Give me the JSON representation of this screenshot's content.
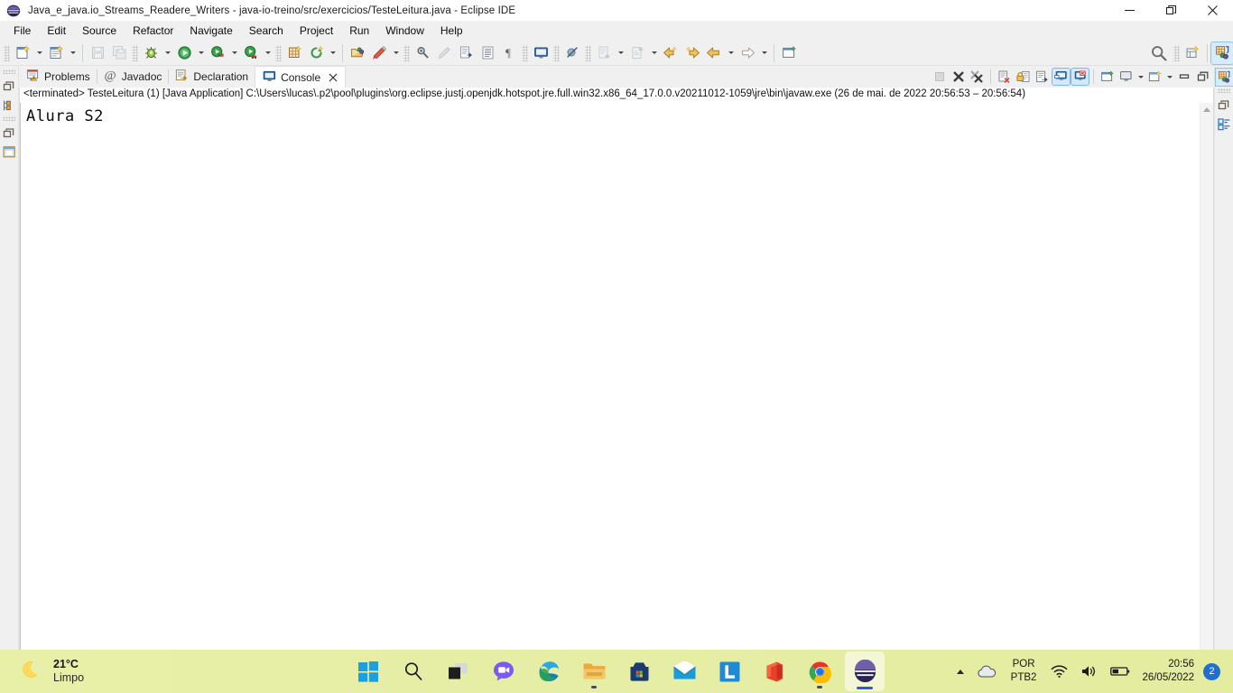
{
  "window": {
    "title": "Java_e_java.io_Streams_Readere_Writers - java-io-treino/src/exercicios/TesteLeitura.java - Eclipse IDE",
    "app_icon": "eclipse-icon",
    "minimize_label": "Minimize",
    "restore_label": "Restore",
    "close_label": "Close"
  },
  "menubar": {
    "items": [
      {
        "label": "File"
      },
      {
        "label": "Edit"
      },
      {
        "label": "Source"
      },
      {
        "label": "Refactor"
      },
      {
        "label": "Navigate"
      },
      {
        "label": "Search"
      },
      {
        "label": "Project"
      },
      {
        "label": "Run"
      },
      {
        "label": "Window"
      },
      {
        "label": "Help"
      }
    ]
  },
  "toolbar": {
    "buttons": [
      {
        "name": "new-wizard-icon",
        "tooltip": "New"
      },
      {
        "name": "new-java-class-icon",
        "tooltip": "New Java Class"
      },
      {
        "name": "save-icon",
        "tooltip": "Save"
      },
      {
        "name": "save-all-icon",
        "tooltip": "Save All"
      },
      {
        "name": "debug-icon",
        "tooltip": "Debug"
      },
      {
        "name": "run-icon",
        "tooltip": "Run"
      },
      {
        "name": "run-coverage-icon",
        "tooltip": "Coverage"
      },
      {
        "name": "run-external-tools-icon",
        "tooltip": "External Tools"
      },
      {
        "name": "new-java-project-icon",
        "tooltip": "New Java Project"
      },
      {
        "name": "refresh-icon",
        "tooltip": "Refresh"
      },
      {
        "name": "open-type-icon",
        "tooltip": "Open Type"
      },
      {
        "name": "open-task-icon",
        "tooltip": "Open Task"
      },
      {
        "name": "search-marker-icon",
        "tooltip": "Search"
      },
      {
        "name": "pencil-icon",
        "tooltip": "Edit"
      },
      {
        "name": "next-annotation-icon",
        "tooltip": "Next Annotation"
      },
      {
        "name": "toggle-block-selection-icon",
        "tooltip": "Toggle Block Selection"
      },
      {
        "name": "show-whitespace-icon",
        "tooltip": "Show Whitespace Characters"
      },
      {
        "name": "terminal-icon",
        "tooltip": "Terminal"
      },
      {
        "name": "skip-breakpoints-icon",
        "tooltip": "Skip All Breakpoints"
      },
      {
        "name": "previous-edit-icon",
        "tooltip": "Previous Edit Location"
      },
      {
        "name": "next-edit-icon",
        "tooltip": "Next Edit Location"
      },
      {
        "name": "back-icon",
        "tooltip": "Back"
      },
      {
        "name": "forward-icon",
        "tooltip": "Forward"
      },
      {
        "name": "new-window-icon",
        "tooltip": "New Window"
      },
      {
        "name": "search-icon",
        "tooltip": "Search"
      },
      {
        "name": "open-perspective-icon",
        "tooltip": "Open Perspective"
      },
      {
        "name": "java-perspective-icon",
        "tooltip": "Java Perspective"
      }
    ]
  },
  "left_rail": {
    "buttons": [
      {
        "name": "restore-view-icon"
      },
      {
        "name": "package-explorer-icon"
      },
      {
        "name": "restore-view-2-icon"
      },
      {
        "name": "outline-view-icon"
      }
    ]
  },
  "right_rail": {
    "buttons": [
      {
        "name": "java-perspective-icon",
        "active": true
      },
      {
        "name": "restore-view-icon",
        "active": false
      },
      {
        "name": "outline-view-icon",
        "active": false
      }
    ]
  },
  "view_tabs": {
    "tabs": [
      {
        "label": "Problems",
        "icon": "problems-icon",
        "selected": false,
        "closable": false
      },
      {
        "label": "Javadoc",
        "icon": "javadoc-icon",
        "selected": false,
        "closable": false
      },
      {
        "label": "Declaration",
        "icon": "declaration-icon",
        "selected": false,
        "closable": false
      },
      {
        "label": "Console",
        "icon": "console-icon",
        "selected": true,
        "closable": true
      }
    ],
    "tools": [
      {
        "name": "terminate-icon",
        "enabled": false
      },
      {
        "name": "remove-launch-icon",
        "enabled": true
      },
      {
        "name": "remove-all-launches-icon",
        "enabled": true
      },
      {
        "name": "clear-console-icon",
        "enabled": true
      },
      {
        "name": "scroll-lock-icon",
        "enabled": true
      },
      {
        "name": "word-wrap-icon",
        "enabled": true
      },
      {
        "name": "show-console-on-output-icon",
        "enabled": true,
        "toggled": true
      },
      {
        "name": "show-console-on-error-icon",
        "enabled": true,
        "toggled": true
      },
      {
        "name": "pin-console-icon",
        "enabled": true
      },
      {
        "name": "display-selected-console-icon",
        "enabled": true
      },
      {
        "name": "open-console-icon",
        "enabled": true
      },
      {
        "name": "minimize-view-icon",
        "enabled": true
      },
      {
        "name": "maximize-view-icon",
        "enabled": true
      }
    ]
  },
  "console": {
    "status_line": "<terminated> TesteLeitura (1) [Java Application] C:\\Users\\lucas\\.p2\\pool\\plugins\\org.eclipse.justj.openjdk.hotspot.jre.full.win32.x86_64_17.0.0.v20211012-1059\\jre\\bin\\javaw.exe  (26 de mai. de 2022 20:56:53 – 20:56:54)",
    "output_lines": [
      "Alura S2"
    ],
    "scroll": {
      "vertical_up": "scroll-up-arrow",
      "vertical_down": "scroll-down-arrow",
      "horizontal_left": "scroll-left-arrow",
      "horizontal_right": "scroll-right-arrow"
    }
  },
  "status_bar": {
    "tip_icon": "light-bulb-icon"
  },
  "taskbar": {
    "weather": {
      "temperature": "21°C",
      "condition": "Limpo",
      "icon": "moon-icon"
    },
    "apps": [
      {
        "name": "start-button",
        "label": "Start",
        "active": false,
        "running": false
      },
      {
        "name": "search-taskbar-button",
        "label": "Search",
        "active": false,
        "running": false
      },
      {
        "name": "task-view-button",
        "label": "Task View",
        "active": false,
        "running": false
      },
      {
        "name": "chat-button",
        "label": "Chat",
        "active": false,
        "running": false
      },
      {
        "name": "microsoft-edge-button",
        "label": "Microsoft Edge",
        "active": false,
        "running": false
      },
      {
        "name": "file-explorer-button",
        "label": "File Explorer",
        "active": false,
        "running": true
      },
      {
        "name": "microsoft-store-button",
        "label": "Microsoft Store",
        "active": false,
        "running": false
      },
      {
        "name": "mail-button",
        "label": "Mail",
        "active": false,
        "running": false
      },
      {
        "name": "linkedin-button",
        "label": "LinkedIn",
        "active": false,
        "running": false
      },
      {
        "name": "microsoft-office-button",
        "label": "Office",
        "active": false,
        "running": false
      },
      {
        "name": "google-chrome-button",
        "label": "Google Chrome",
        "active": false,
        "running": true
      },
      {
        "name": "eclipse-button",
        "label": "Eclipse IDE",
        "active": true,
        "running": true
      }
    ],
    "tray": {
      "overflow_icon": "chevron-up-icon",
      "onedrive_icon": "cloud-icon",
      "language_primary": "POR",
      "language_secondary": "PTB2",
      "wifi_icon": "wifi-icon",
      "volume_icon": "speaker-icon",
      "battery_icon": "battery-icon",
      "time": "20:56",
      "date": "26/05/2022",
      "notification_count": "2"
    }
  },
  "colors": {
    "accent": "#2b5bd7",
    "taskbar_bg": "#e6eea6",
    "console_bg": "#ffffff",
    "chrome_bg": "#f0f0f0",
    "toggle_active": "#d3e9fb"
  }
}
